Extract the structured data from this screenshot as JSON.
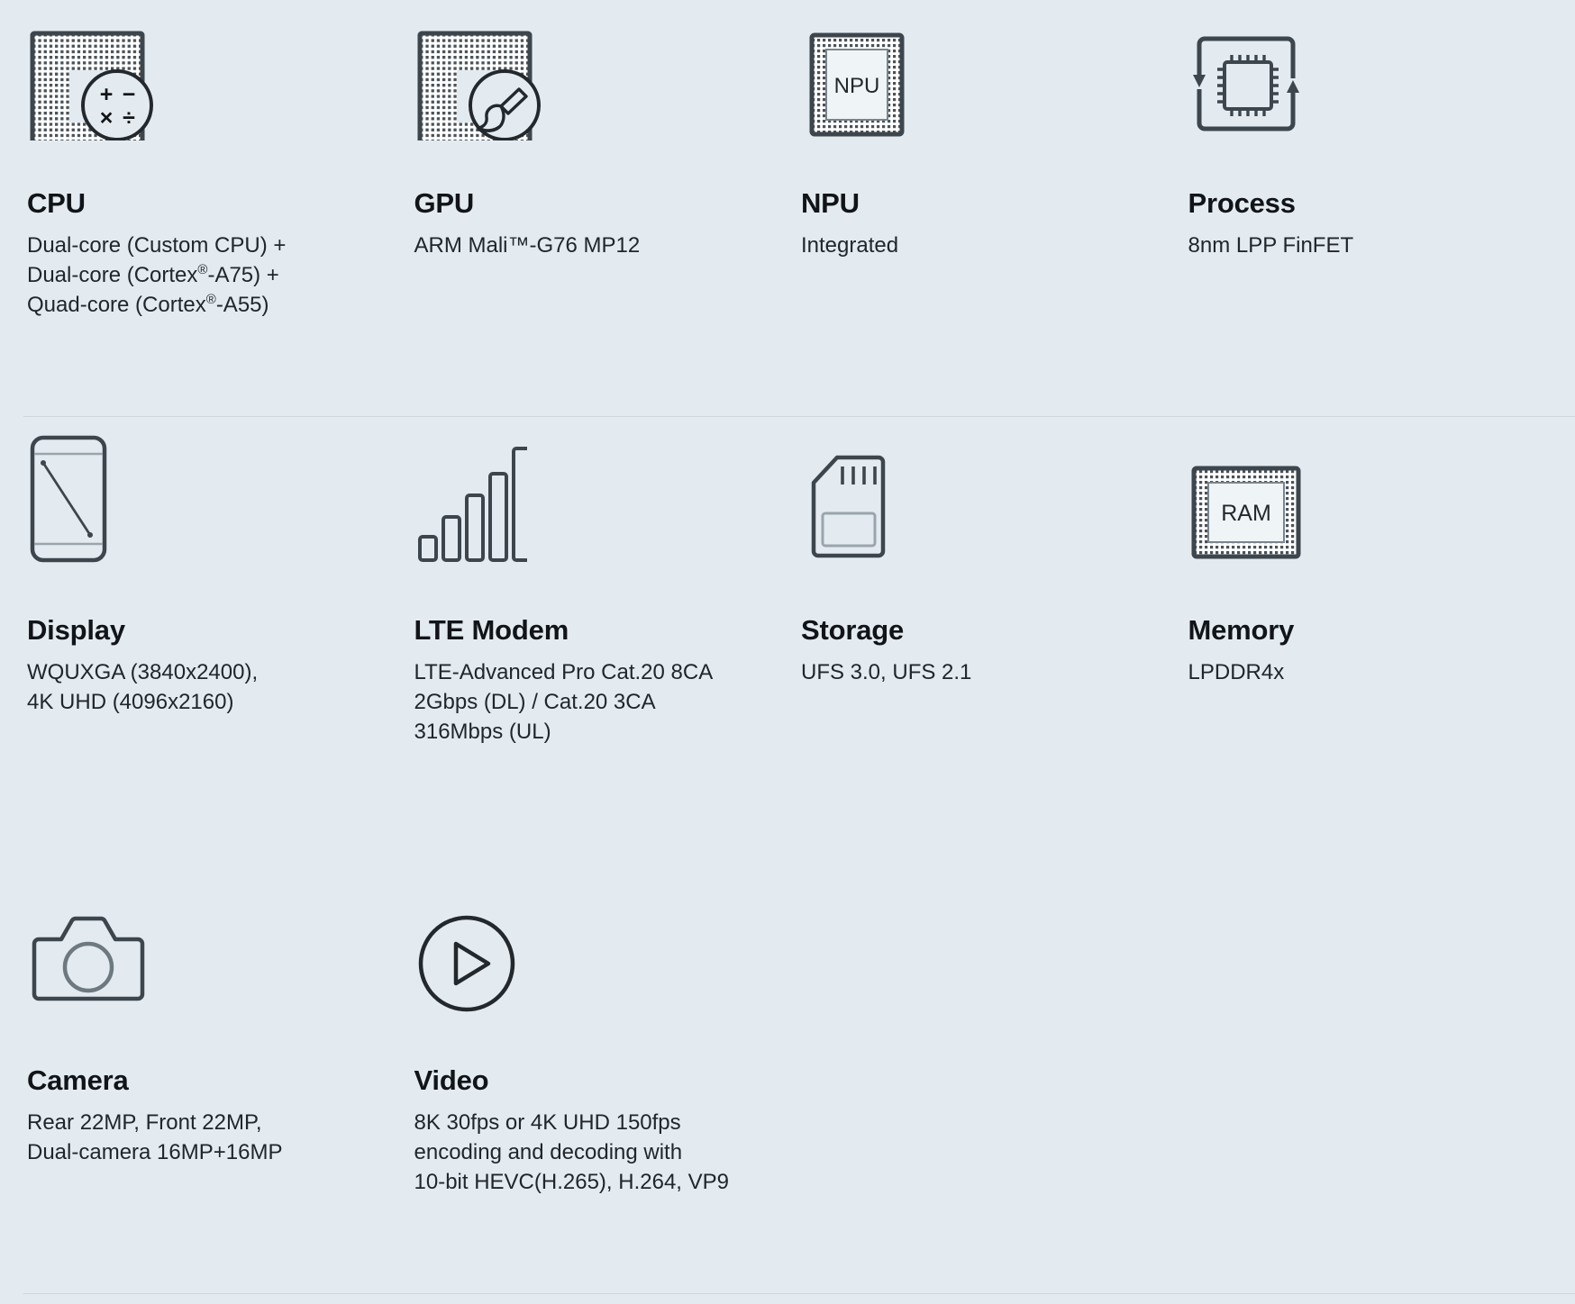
{
  "page": {
    "background_color": "#e3ebf1",
    "divider_color": "#cdd6dc",
    "text_color": "#20262b",
    "heading_color": "#111418",
    "icon_color": "#3e464d"
  },
  "rows": [
    {
      "cells": [
        {
          "icon": "cpu-chip-calculator-icon",
          "title": "CPU",
          "desc_lines": [
            "Dual-core (Custom CPU) +",
            "Dual-core (Cortex®-A75) +",
            "Quad-core (Cortex®-A55)"
          ],
          "desc": "Dual-core (Custom CPU) +\nDual-core (Cortex®-A75) +\nQuad-core (Cortex®-A55)"
        },
        {
          "icon": "gpu-chip-brush-icon",
          "title": "GPU",
          "desc_lines": [
            "ARM Mali™-G76 MP12"
          ],
          "desc": "ARM Mali™-G76 MP12"
        },
        {
          "icon": "npu-chip-icon",
          "icon_label": "NPU",
          "title": "NPU",
          "desc_lines": [
            "Integrated"
          ],
          "desc": "Integrated"
        },
        {
          "icon": "process-cycle-chip-icon",
          "title": "Process",
          "desc_lines": [
            "8nm LPP FinFET"
          ],
          "desc": "8nm LPP FinFET"
        }
      ]
    },
    {
      "cells": [
        {
          "icon": "display-phone-diagonal-icon",
          "title": "Display",
          "desc_lines": [
            "WQUXGA (3840x2400),",
            "4K UHD (4096x2160)"
          ],
          "desc": "WQUXGA (3840x2400),\n4K UHD (4096x2160)"
        },
        {
          "icon": "signal-bars-icon",
          "title": "LTE Modem",
          "desc_lines": [
            "LTE-Advanced Pro Cat.20 8CA",
            "2Gbps (DL) / Cat.20 3CA",
            "316Mbps (UL)"
          ],
          "desc": "LTE-Advanced Pro Cat.20 8CA\n2Gbps (DL) / Cat.20 3CA\n316Mbps (UL)"
        },
        {
          "icon": "sd-card-icon",
          "title": "Storage",
          "desc_lines": [
            "UFS 3.0, UFS 2.1"
          ],
          "desc": "UFS 3.0, UFS 2.1"
        },
        {
          "icon": "ram-chip-icon",
          "icon_label": "RAM",
          "title": "Memory",
          "desc_lines": [
            "LPDDR4x"
          ],
          "desc": "LPDDR4x"
        }
      ]
    },
    {
      "cells": [
        {
          "icon": "camera-icon",
          "title": "Camera",
          "desc_lines": [
            "Rear 22MP, Front 22MP,",
            "Dual-camera 16MP+16MP"
          ],
          "desc": "Rear 22MP, Front 22MP,\nDual-camera 16MP+16MP"
        },
        {
          "icon": "video-play-circle-icon",
          "title": "Video",
          "desc_lines": [
            "8K 30fps or 4K UHD 150fps",
            "encoding and decoding with",
            "10-bit HEVC(H.265), H.264, VP9"
          ],
          "desc": "8K 30fps or 4K UHD 150fps\nencoding and decoding with\n10-bit HEVC(H.265), H.264, VP9"
        }
      ]
    }
  ]
}
